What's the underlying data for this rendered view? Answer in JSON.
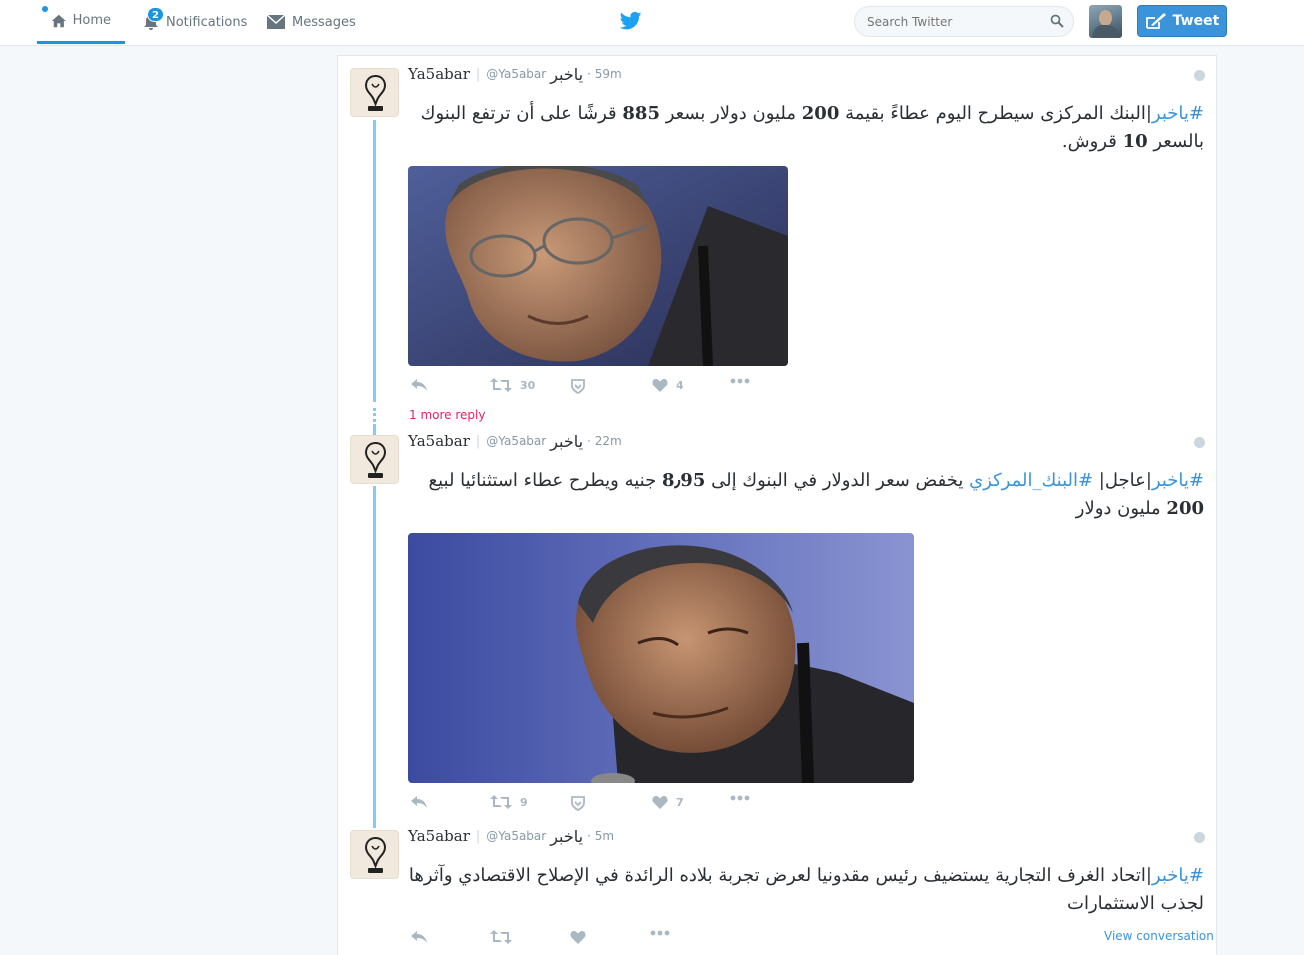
{
  "nav": {
    "home": "Home",
    "notifications": "Notifications",
    "notifications_badge": "2",
    "messages": "Messages"
  },
  "search": {
    "placeholder": "Search Twitter"
  },
  "tweet_button": "Tweet",
  "colors": {
    "accent": "#3b94d9",
    "thread_line": "#88c9f0",
    "reply_link": "#e0245e"
  },
  "tweets": [
    {
      "name": "Ya5abar",
      "handle": "@Ya5abar",
      "handle_ar": "ياخبر",
      "time": "59m",
      "text_hash": "#ياخبر",
      "text_a": "|البنك المركزى سيطرح  اليوم عطاءً بقيمة ",
      "text_b": "200",
      "text_c": " مليون دولار بسعر ",
      "text_d": "885",
      "text_e": " قرشًا على أن ترتفع البنوك بالسعر ",
      "text_f": "10",
      "text_g": " قروش.",
      "retweets": "30",
      "likes": "4"
    },
    {
      "name": "Ya5abar",
      "handle": "@Ya5abar",
      "handle_ar": "ياخبر",
      "time": "22m",
      "text_hash": "#ياخبر",
      "text_a": "|عاجل| ",
      "text_hash2": "#البنك_المركزي",
      "text_b": " يخفض سعر الدولار في البنوك إلى ",
      "text_c": "8٫95",
      "text_d": " جنيه ويطرح عطاء استثنائيا لبيع ",
      "text_e": "200",
      "text_f": " مليون دولار",
      "retweets": "9",
      "likes": "7"
    },
    {
      "name": "Ya5abar",
      "handle": "@Ya5abar",
      "handle_ar": "ياخبر",
      "time": "5m",
      "text_hash": "#ياخبر",
      "text_a": "|اتحاد الغرف التجارية يستضيف رئيس مقدونيا لعرض تجربة بلاده الرائدة في الإصلاح الاقتصادي وآثرها  لجذب الاستثمارات"
    }
  ],
  "more_reply": "1 more reply",
  "view_conversation": "View conversation"
}
